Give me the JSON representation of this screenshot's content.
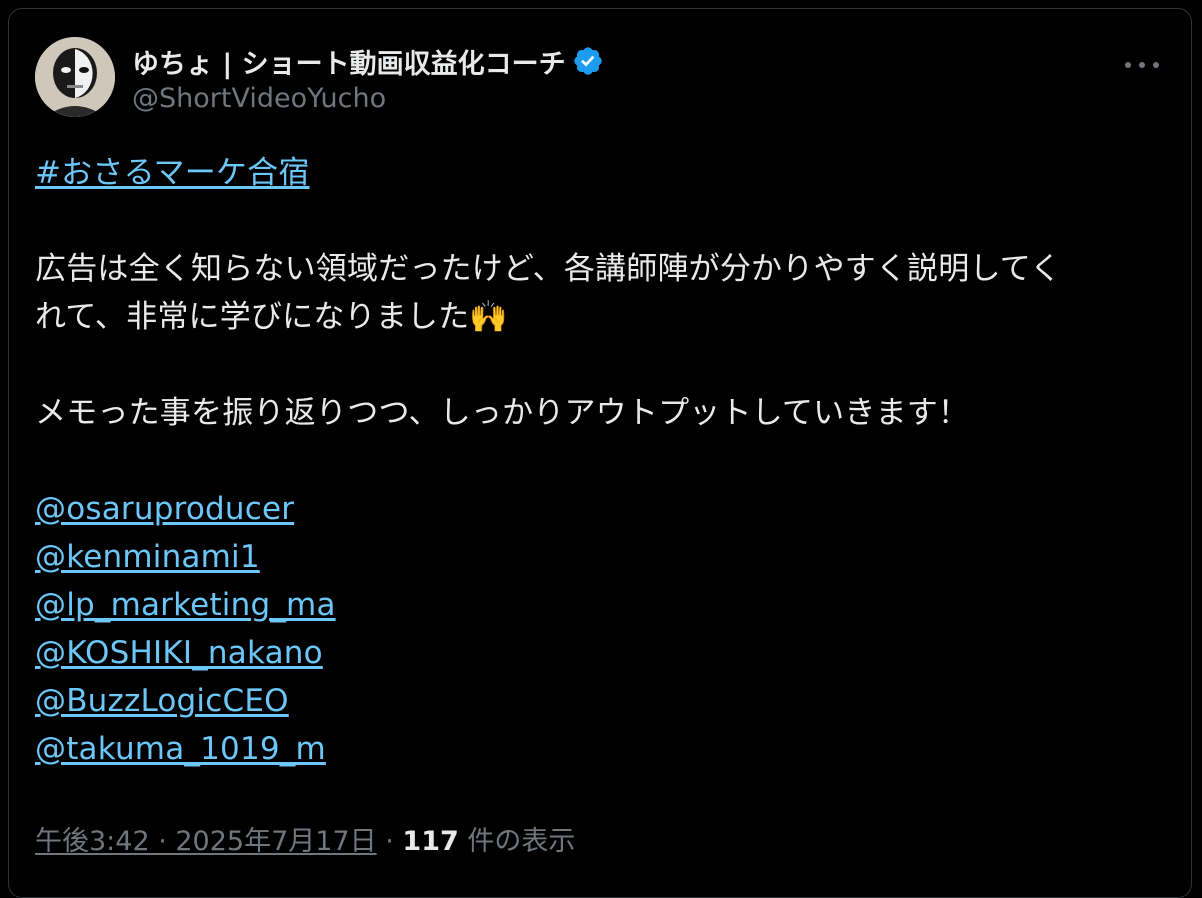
{
  "author": {
    "display_name": "ゆちょ | ショート動画収益化コーチ",
    "handle": "@ShortVideoYucho",
    "verified_icon": "verified-badge-icon",
    "verified_color": "#1d9bf0"
  },
  "menu": {
    "icon": "more-horizontal-icon"
  },
  "tweet": {
    "hashtag": "#おさるマーケ合宿",
    "paragraph1_line1": "広告は全く知らない領域だったけど、各講師陣が分かりやすく説明してく",
    "paragraph1_line2": "れて、非常に学びになりました",
    "emoji": "🙌",
    "paragraph2": "メモった事を振り返りつつ、しっかりアウトプットしていきます！",
    "mentions": [
      "@osaruproducer",
      "@kenminami1",
      "@lp_marketing_ma",
      "@KOSHIKI_nakano",
      "@BuzzLogicCEO",
      "@takuma_1019_m"
    ]
  },
  "footer": {
    "timestamp": "午後3:42 · 2025年7月17日",
    "separator": "·",
    "view_count": "117",
    "view_suffix": "件の表示"
  },
  "colors": {
    "background": "#000000",
    "text": "#e7e9ea",
    "secondary": "#71767b",
    "link": "#6cc6f7",
    "border": "#2f3336"
  }
}
